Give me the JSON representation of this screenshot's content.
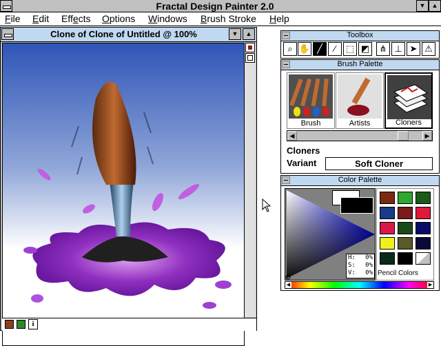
{
  "app": {
    "title": "Fractal Design Painter 2.0"
  },
  "menu": [
    {
      "accel": "F",
      "rest": "ile"
    },
    {
      "accel": "E",
      "rest": "dit"
    },
    {
      "pre": "Eff",
      "accel": "e",
      "rest": "cts"
    },
    {
      "accel": "O",
      "rest": "ptions"
    },
    {
      "accel": "W",
      "rest": "indows"
    },
    {
      "accel": "B",
      "rest": "rush Stroke"
    },
    {
      "accel": "H",
      "rest": "elp"
    }
  ],
  "document": {
    "title": "Clone of Clone of Untitled @ 100%"
  },
  "toolbox": {
    "title": "Toolbox",
    "tools": [
      "magnifier-icon",
      "grabber-hand-icon",
      "brush-icon",
      "dropper-icon",
      "rectangle-select-icon",
      "bucket-icon",
      "brush-variant-icon",
      "frisket-icon",
      "pointer-icon",
      "warning-triangle-icon"
    ]
  },
  "brush_palette": {
    "title": "Brush Palette",
    "brushes": [
      {
        "label": "Brush"
      },
      {
        "label": "Artists"
      },
      {
        "label": "Cloners"
      }
    ],
    "selected_brush": "Cloners",
    "variant_label": "Variant",
    "variant_value": "Soft Cloner"
  },
  "color_palette": {
    "title": "Color Palette",
    "hsv": {
      "h_label": "H:",
      "h_value": "0%",
      "s_label": "S:",
      "s_value": "0%",
      "v_label": "V:",
      "v_value": "0%"
    },
    "set_label": "Pencil Colors",
    "swatches": [
      "#7a2a10",
      "#2ea82e",
      "#1a5a1a",
      "#1a3a8a",
      "#7a1a1a",
      "#e01a3a",
      "#d8184a",
      "#1a4a1a",
      "#0a0a6a",
      "#f0f020",
      "#5a5a2a",
      "#0a0a3a",
      "#0a2a1a",
      "#000000"
    ]
  },
  "colors": {
    "titlebar": "#c0d8f0",
    "face": "#c0c0c0"
  }
}
